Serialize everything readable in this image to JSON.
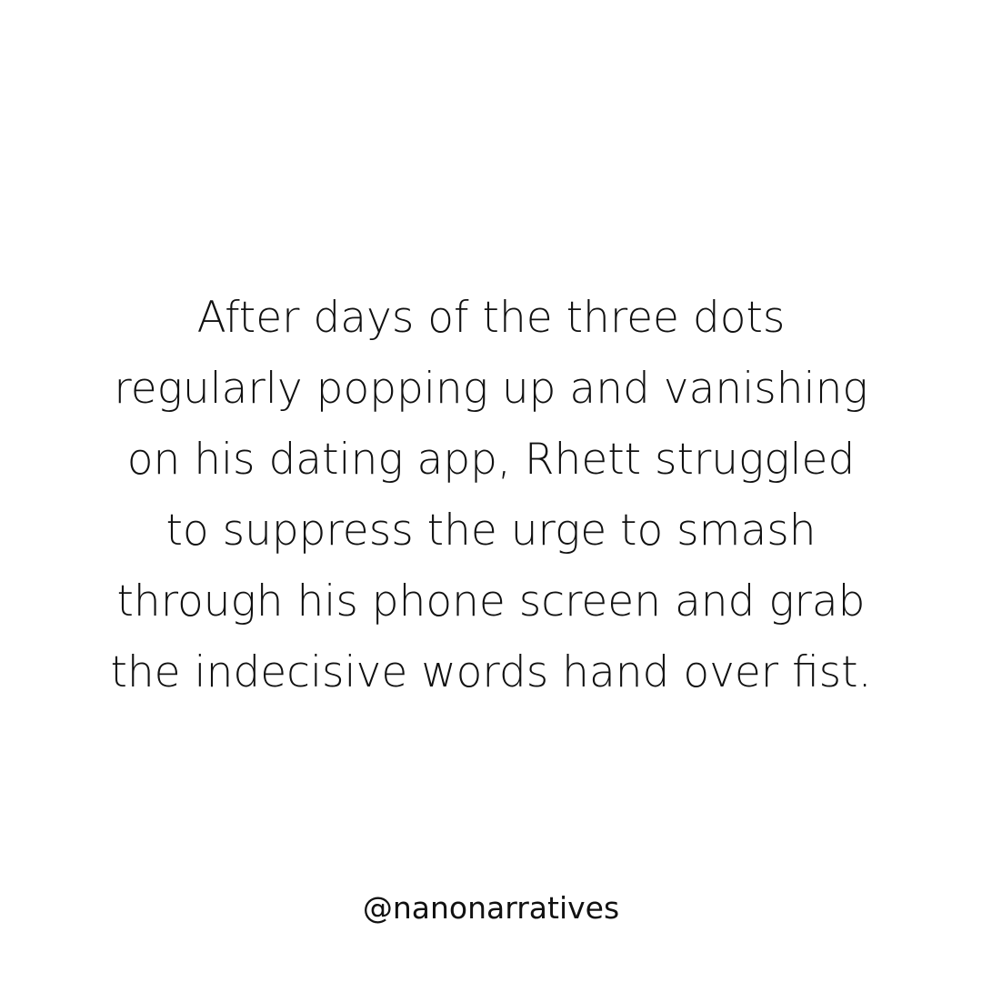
{
  "post": {
    "lines": [
      "After days of the three dots",
      "regularly popping up and vanishing",
      "on his dating app, Rhett struggled",
      "to suppress the urge to smash",
      "through his phone screen and grab",
      "the indecisive words hand over fist."
    ],
    "handle": "@nanonarratives"
  },
  "colors": {
    "background": "#ffffff",
    "text": "#111111"
  }
}
